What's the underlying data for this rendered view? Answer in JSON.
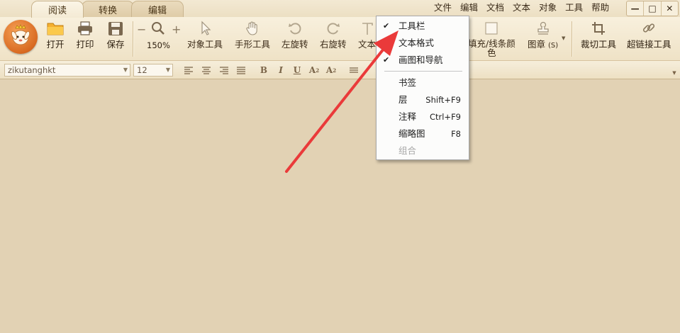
{
  "tabs": [
    {
      "label": "阅读"
    },
    {
      "label": "转换"
    },
    {
      "label": "编辑"
    }
  ],
  "menubar": {
    "items": [
      {
        "label": "文件"
      },
      {
        "label": "编辑"
      },
      {
        "label": "文档"
      },
      {
        "label": "文本"
      },
      {
        "label": "对象"
      },
      {
        "label": "工具"
      },
      {
        "label": "帮助"
      }
    ]
  },
  "window_controls": {
    "minimize": "—",
    "maximize": "□",
    "close": "✕"
  },
  "toolbar": {
    "open": "打开",
    "print": "打印",
    "save": "保存",
    "zoom_minus": "−",
    "zoom_plus": "+",
    "zoom_value": "150%",
    "object_tool": "对象工具",
    "hand_tool": "手形工具",
    "rotate_left": "左旋转",
    "rotate_right": "右旋转",
    "text": "文本",
    "fill_line_color_1": "填充/线条颜",
    "fill_line_color_2": "色",
    "stamp": "图章",
    "stamp_shortcut": "(S)",
    "crop_tool": "裁切工具",
    "hyperlink_tool": "超链接工具"
  },
  "format_bar": {
    "font_name": "zikutanghkt",
    "font_size": "12",
    "bold": "B",
    "italic": "I",
    "underline": "U",
    "superscript": "A",
    "subscript": "A"
  },
  "context_menu": {
    "items": [
      {
        "label": "工具栏",
        "checked": "✔",
        "shortcut": ""
      },
      {
        "label": "文本格式",
        "checked": "",
        "shortcut": ""
      },
      {
        "label": "画图和导航",
        "checked": "✔",
        "shortcut": ""
      },
      {
        "label": "书签",
        "checked": "",
        "shortcut": ""
      },
      {
        "label": "层",
        "checked": "",
        "shortcut": "Shift+F9"
      },
      {
        "label": "注释",
        "checked": "",
        "shortcut": "Ctrl+F9"
      },
      {
        "label": "缩略图",
        "checked": "",
        "shortcut": "F8"
      },
      {
        "label": "组合",
        "checked": "",
        "shortcut": ""
      }
    ]
  },
  "colors": {
    "accent": "#e9463f",
    "background": "#e2d2b4",
    "logo": "#e07a2c"
  }
}
